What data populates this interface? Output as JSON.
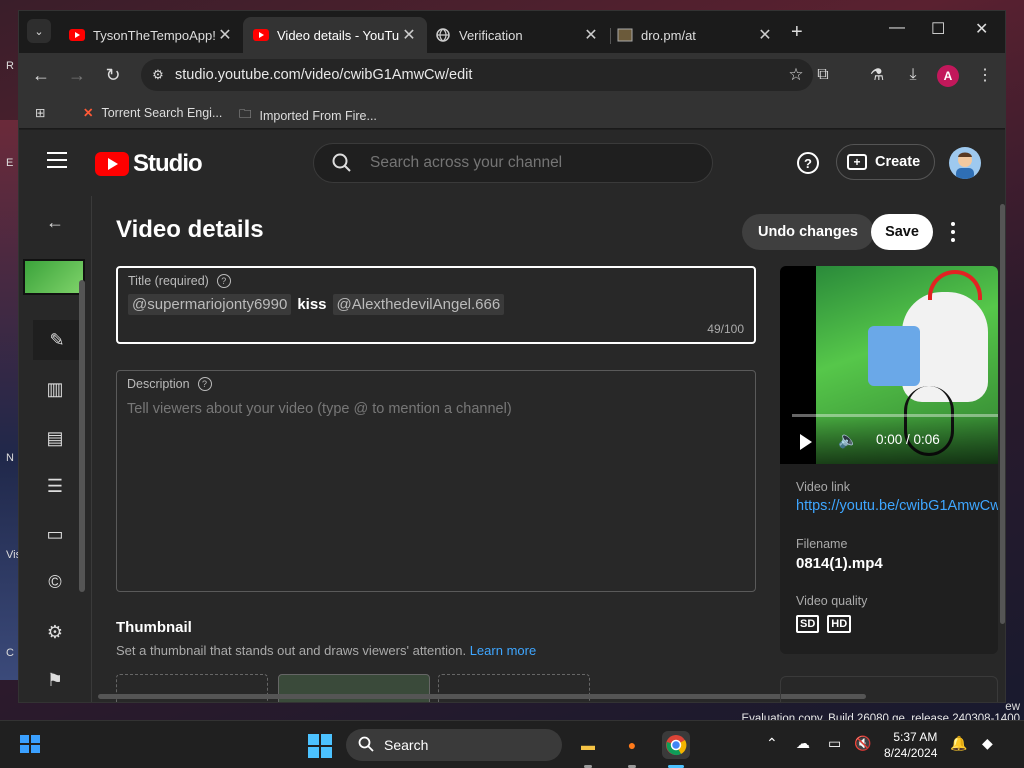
{
  "desktop": {
    "eval_line1": "ew",
    "eval_line2": "Evaluation copy. Build 26080.ge_release.240308-1400",
    "icon_labels": [
      "R",
      "E",
      "N",
      "Vis",
      "C"
    ]
  },
  "browser": {
    "tabs": [
      {
        "title": "TysonTheTempoApp!",
        "favicon": "youtube-icon"
      },
      {
        "title": "Video details - YouTu",
        "favicon": "youtube-icon"
      },
      {
        "title": "Verification",
        "favicon": "globe-icon"
      },
      {
        "title": "dro.pm/at",
        "favicon": "image-icon"
      }
    ],
    "url": "studio.youtube.com/video/cwibG1AmwCw/edit",
    "profile_initial": "A",
    "bookmarks": [
      {
        "label": "Torrent Search Engi...",
        "icon": "bookmark-x-icon"
      },
      {
        "label": "Imported From Fire...",
        "icon": "folder-icon"
      }
    ]
  },
  "studio": {
    "logo_text": "Studio",
    "search_placeholder": "Search across your channel",
    "create_label": "Create",
    "page_title": "Video details",
    "undo_label": "Undo changes",
    "save_label": "Save",
    "title_field": {
      "label": "Title (required)",
      "mention1": "@supermariojonty6990",
      "plain": "kiss",
      "mention2": "@AlexthedevilAngel.666",
      "counter": "49/100"
    },
    "description_field": {
      "label": "Description",
      "placeholder": "Tell viewers about your video (type @ to mention a channel)"
    },
    "thumbnail": {
      "heading": "Thumbnail",
      "subtitle": "Set a thumbnail that stands out and draws viewers' attention.",
      "learn_more": "Learn more"
    },
    "video_card": {
      "time": "0:00 / 0:06",
      "link_label": "Video link",
      "link": "https://youtu.be/cwibG1AmwCw",
      "filename_label": "Filename",
      "filename": "0814(1).mp4",
      "quality_label": "Video quality",
      "qualities": [
        "SD",
        "HD"
      ]
    }
  },
  "taskbar": {
    "search_label": "Search",
    "time": "5:37 AM",
    "date": "8/24/2024"
  }
}
